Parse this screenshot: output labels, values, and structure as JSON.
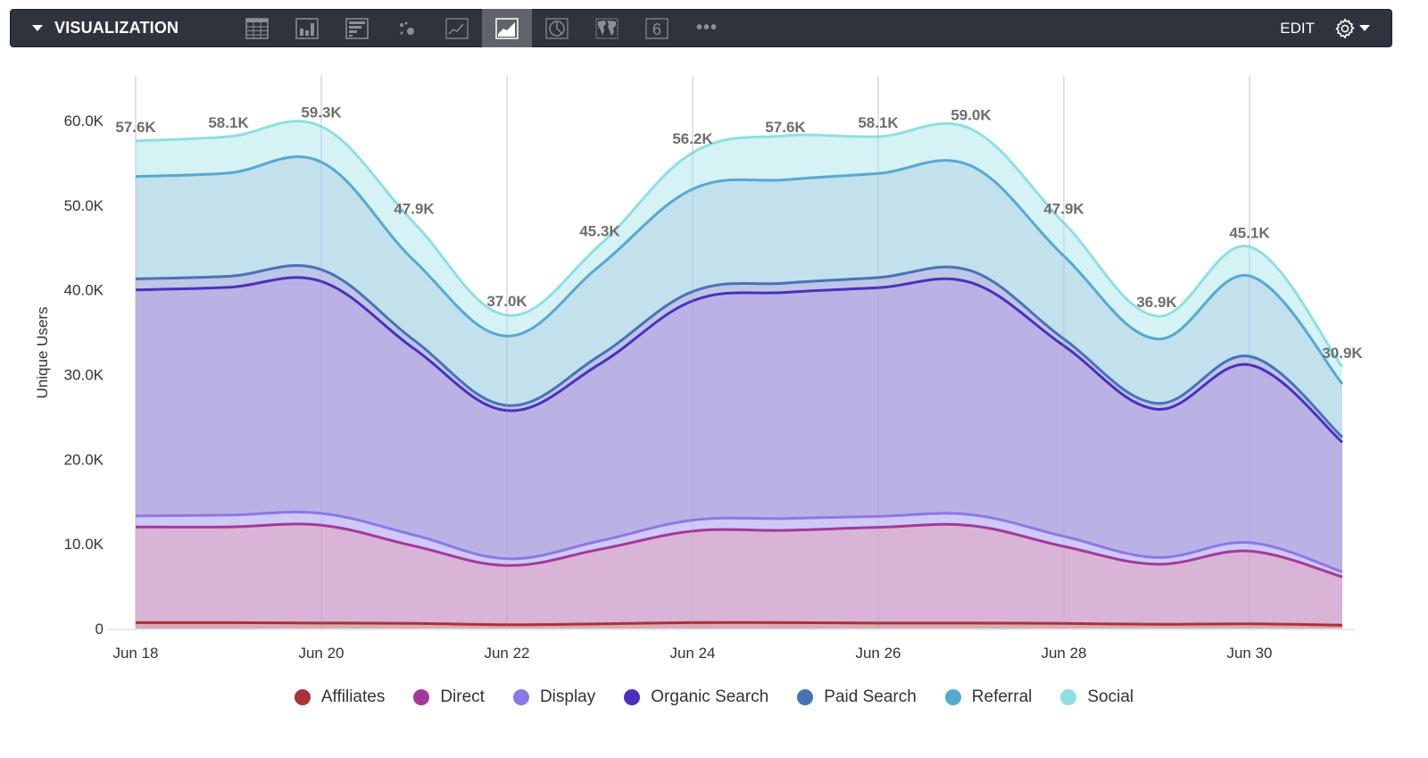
{
  "toolbar": {
    "title": "VISUALIZATION",
    "icons": [
      {
        "name": "table-icon",
        "active": false
      },
      {
        "name": "column-chart-icon",
        "active": false
      },
      {
        "name": "bar-chart-icon",
        "active": false
      },
      {
        "name": "scatter-chart-icon",
        "active": false
      },
      {
        "name": "line-chart-icon",
        "active": false
      },
      {
        "name": "area-chart-icon",
        "active": true
      },
      {
        "name": "pie-chart-icon",
        "active": false
      },
      {
        "name": "map-icon",
        "active": false
      },
      {
        "name": "single-value-icon",
        "active": false
      }
    ],
    "single_value_glyph": "6",
    "more_label": "•••",
    "edit_label": "EDIT"
  },
  "chart_data": {
    "type": "area",
    "stacked": true,
    "title": "",
    "xlabel": "",
    "ylabel": "Unique Users",
    "ylim": [
      0,
      65000
    ],
    "yticks": [
      0,
      10000,
      20000,
      30000,
      40000,
      50000,
      60000
    ],
    "ytick_labels": [
      "0",
      "10.0K",
      "20.0K",
      "30.0K",
      "40.0K",
      "50.0K",
      "60.0K"
    ],
    "x": [
      "Jun 18",
      "Jun 19",
      "Jun 20",
      "Jun 21",
      "Jun 22",
      "Jun 23",
      "Jun 24",
      "Jun 25",
      "Jun 26",
      "Jun 27",
      "Jun 28",
      "Jun 29",
      "Jun 30",
      "Jul 1"
    ],
    "xtick_labels": [
      "Jun 18",
      "Jun 20",
      "Jun 22",
      "Jun 24",
      "Jun 26",
      "Jun 28",
      "Jun 30"
    ],
    "xtick_indices": [
      0,
      2,
      4,
      6,
      8,
      10,
      12
    ],
    "grid": "vertical",
    "legend_position": "bottom",
    "series": [
      {
        "name": "Affiliates",
        "color": "#a8323a",
        "fill": "#dba7b0",
        "values": [
          700,
          700,
          650,
          600,
          450,
          550,
          700,
          700,
          650,
          650,
          600,
          500,
          550,
          400
        ]
      },
      {
        "name": "Direct",
        "color": "#a2399b",
        "fill": "#d8b0d4",
        "values": [
          11300,
          11300,
          11550,
          9150,
          7000,
          8800,
          10800,
          10900,
          11300,
          11500,
          9100,
          7100,
          8600,
          5700
        ]
      },
      {
        "name": "Display",
        "color": "#8b78e6",
        "fill": "#cec5f5",
        "values": [
          1300,
          1400,
          1400,
          1300,
          800,
          1000,
          1300,
          1400,
          1300,
          1300,
          1200,
          800,
          1000,
          600
        ]
      },
      {
        "name": "Organic Search",
        "color": "#4c2fbf",
        "fill": "#b6aee4",
        "values": [
          26700,
          26900,
          27400,
          22000,
          17500,
          20900,
          25900,
          26700,
          27000,
          27400,
          22500,
          17500,
          21000,
          15300
        ]
      },
      {
        "name": "Paid Search",
        "color": "#4872b8",
        "fill": "#b9c3e4",
        "values": [
          1300,
          1300,
          1400,
          1000,
          600,
          1000,
          1100,
          1100,
          1200,
          1400,
          800,
          700,
          1000,
          600
        ]
      },
      {
        "name": "Referral",
        "color": "#56a9d0",
        "fill": "#bfdfec",
        "values": [
          12100,
          12200,
          12700,
          9400,
          8200,
          10600,
          12100,
          12200,
          12300,
          12400,
          9800,
          7600,
          9500,
          6300
        ]
      },
      {
        "name": "Social",
        "color": "#8edfe2",
        "fill": "#d3f1f3",
        "values": [
          4200,
          4300,
          4200,
          4450,
          2450,
          2450,
          4300,
          5200,
          4350,
          4350,
          3900,
          2700,
          3450,
          2000
        ]
      }
    ],
    "totals": [
      57600,
      58100,
      59300,
      47900,
      37000,
      45300,
      56200,
      57600,
      58100,
      59000,
      47900,
      36900,
      45100,
      30900
    ],
    "total_labels": [
      "57.6K",
      "58.1K",
      "59.3K",
      "47.9K",
      "37.0K",
      "45.3K",
      "56.2K",
      "57.6K",
      "58.1K",
      "59.0K",
      "47.9K",
      "36.9K",
      "45.1K",
      "30.9K"
    ]
  },
  "legend": [
    {
      "label": "Affiliates",
      "color": "#a8323a"
    },
    {
      "label": "Direct",
      "color": "#a2399b"
    },
    {
      "label": "Display",
      "color": "#8b78e6"
    },
    {
      "label": "Organic Search",
      "color": "#4c2fbf"
    },
    {
      "label": "Paid Search",
      "color": "#4872b8"
    },
    {
      "label": "Referral",
      "color": "#56a9d0"
    },
    {
      "label": "Social",
      "color": "#8edfe2"
    }
  ]
}
